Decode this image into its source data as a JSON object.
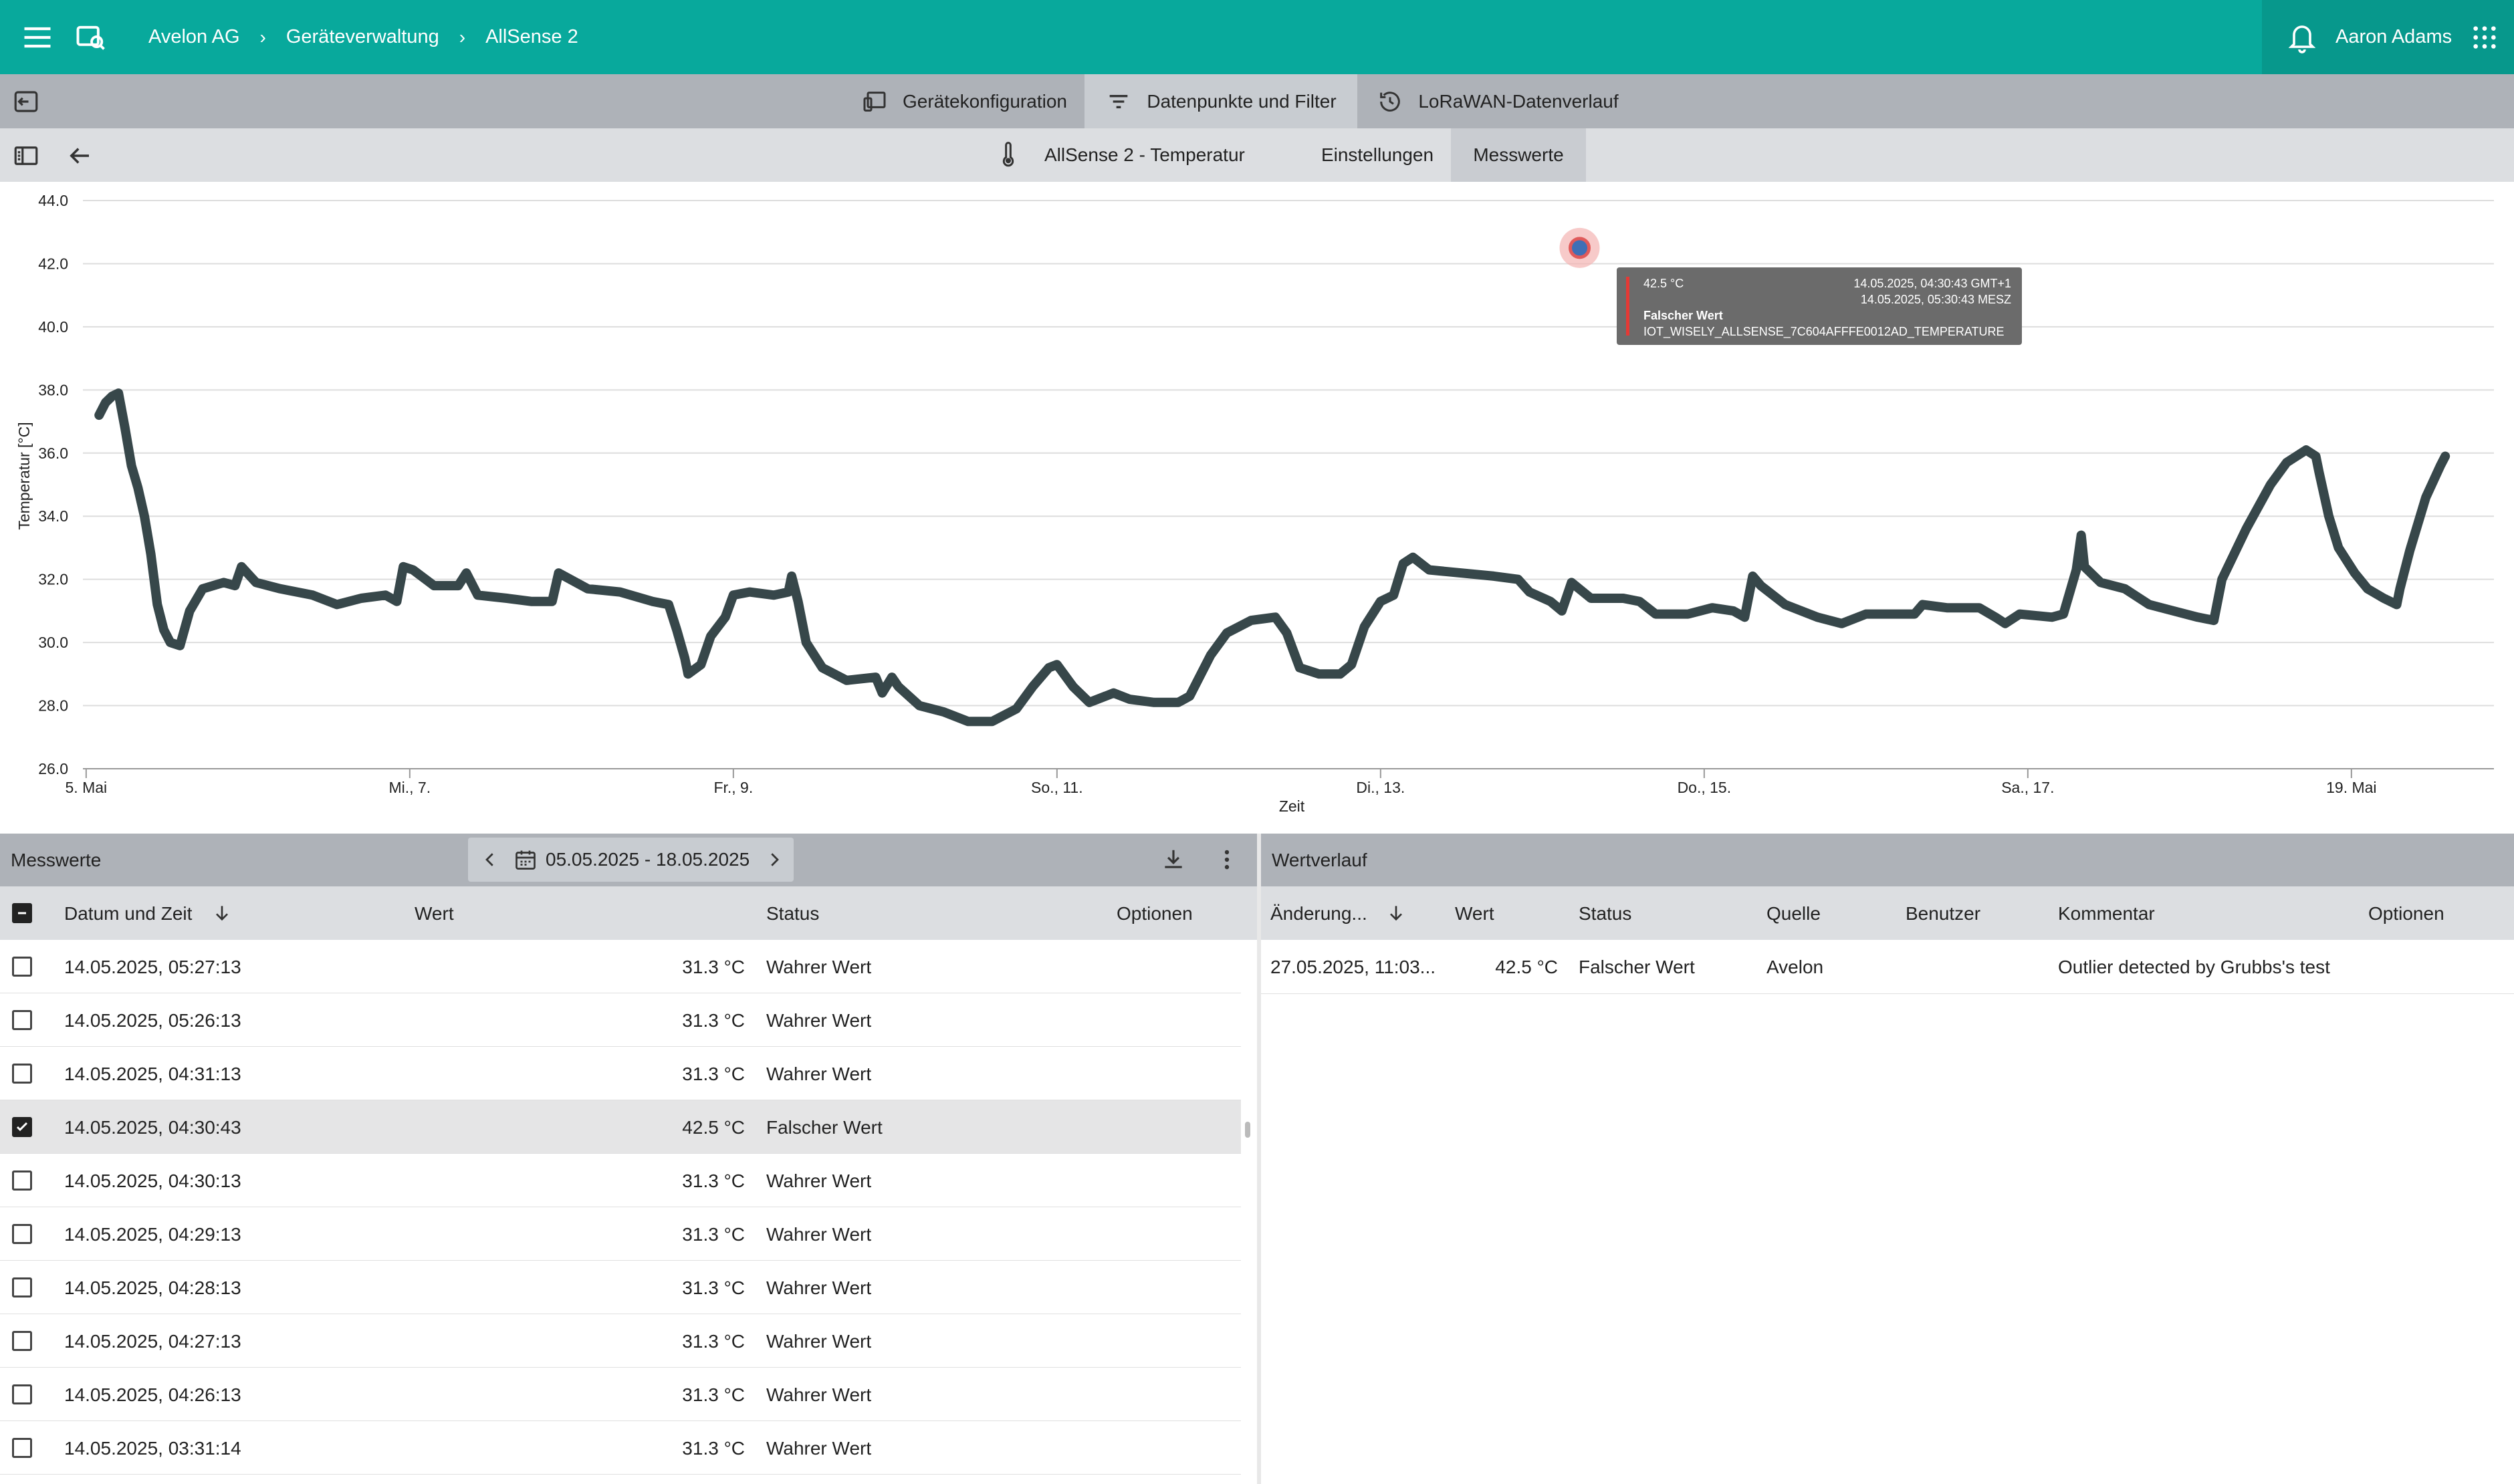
{
  "topbar": {
    "breadcrumb": [
      "Avelon AG",
      "Geräteverwaltung",
      "AllSense 2"
    ],
    "breadcrumb_sep": "›",
    "user_name": "Aaron Adams",
    "color": "#08a99c"
  },
  "tabs_main": [
    {
      "label": "Gerätekonfiguration",
      "icon": "devices-icon",
      "active": false
    },
    {
      "label": "Datenpunkte und Filter",
      "icon": "filter-icon",
      "active": true
    },
    {
      "label": "LoRaWAN-Datenverlauf",
      "icon": "history-icon",
      "active": false
    }
  ],
  "tabs_sub": {
    "datapoint": "AllSense 2 - Temperatur",
    "settings": "Einstellungen",
    "values": "Messwerte"
  },
  "chart_data": {
    "type": "line",
    "xlabel": "Zeit",
    "ylabel": "Temperatur [°C]",
    "ylim": [
      26,
      44
    ],
    "yticks": [
      "44.0",
      "42.0",
      "40.0",
      "38.0",
      "36.0",
      "34.0",
      "32.0",
      "30.0",
      "28.0",
      "26.0"
    ],
    "xlim_days": [
      5,
      19.5
    ],
    "xticks": [
      {
        "day": 5,
        "label": "5. Mai"
      },
      {
        "day": 7,
        "label": "Mi., 7."
      },
      {
        "day": 9,
        "label": "Fr., 9."
      },
      {
        "day": 11,
        "label": "So., 11."
      },
      {
        "day": 13,
        "label": "Di., 13."
      },
      {
        "day": 15,
        "label": "Do., 15."
      },
      {
        "day": 17,
        "label": "Sa., 17."
      },
      {
        "day": 19,
        "label": "19. Mai"
      }
    ],
    "grid": true,
    "series": [
      {
        "color": "#37474a",
        "points": [
          [
            5.08,
            37.2
          ],
          [
            5.12,
            37.6
          ],
          [
            5.16,
            37.8
          ],
          [
            5.2,
            37.9
          ],
          [
            5.24,
            36.8
          ],
          [
            5.28,
            35.6
          ],
          [
            5.32,
            34.9
          ],
          [
            5.36,
            34.0
          ],
          [
            5.4,
            32.8
          ],
          [
            5.44,
            31.2
          ],
          [
            5.48,
            30.4
          ],
          [
            5.52,
            30.0
          ],
          [
            5.58,
            29.9
          ],
          [
            5.64,
            31.0
          ],
          [
            5.72,
            31.7
          ],
          [
            5.85,
            31.9
          ],
          [
            5.92,
            31.8
          ],
          [
            5.96,
            32.4
          ],
          [
            6.05,
            31.9
          ],
          [
            6.2,
            31.7
          ],
          [
            6.4,
            31.5
          ],
          [
            6.55,
            31.2
          ],
          [
            6.7,
            31.4
          ],
          [
            6.85,
            31.5
          ],
          [
            6.92,
            31.3
          ],
          [
            6.96,
            32.4
          ],
          [
            7.02,
            32.3
          ],
          [
            7.15,
            31.8
          ],
          [
            7.3,
            31.8
          ],
          [
            7.35,
            32.2
          ],
          [
            7.42,
            31.5
          ],
          [
            7.6,
            31.4
          ],
          [
            7.75,
            31.3
          ],
          [
            7.88,
            31.3
          ],
          [
            7.92,
            32.2
          ],
          [
            8.1,
            31.7
          ],
          [
            8.3,
            31.6
          ],
          [
            8.5,
            31.3
          ],
          [
            8.6,
            31.2
          ],
          [
            8.65,
            30.4
          ],
          [
            8.7,
            29.5
          ],
          [
            8.72,
            29.0
          ],
          [
            8.8,
            29.3
          ],
          [
            8.86,
            30.2
          ],
          [
            8.95,
            30.8
          ],
          [
            9.0,
            31.5
          ],
          [
            9.1,
            31.6
          ],
          [
            9.25,
            31.5
          ],
          [
            9.34,
            31.6
          ],
          [
            9.36,
            32.1
          ],
          [
            9.4,
            31.3
          ],
          [
            9.45,
            30.0
          ],
          [
            9.55,
            29.2
          ],
          [
            9.7,
            28.8
          ],
          [
            9.88,
            28.9
          ],
          [
            9.92,
            28.4
          ],
          [
            9.98,
            28.9
          ],
          [
            10.02,
            28.6
          ],
          [
            10.15,
            28.0
          ],
          [
            10.3,
            27.8
          ],
          [
            10.45,
            27.5
          ],
          [
            10.6,
            27.5
          ],
          [
            10.75,
            27.9
          ],
          [
            10.85,
            28.6
          ],
          [
            10.95,
            29.2
          ],
          [
            11.0,
            29.3
          ],
          [
            11.1,
            28.6
          ],
          [
            11.2,
            28.1
          ],
          [
            11.35,
            28.4
          ],
          [
            11.45,
            28.2
          ],
          [
            11.6,
            28.1
          ],
          [
            11.75,
            28.1
          ],
          [
            11.82,
            28.3
          ],
          [
            11.95,
            29.6
          ],
          [
            12.05,
            30.3
          ],
          [
            12.2,
            30.7
          ],
          [
            12.35,
            30.8
          ],
          [
            12.42,
            30.3
          ],
          [
            12.5,
            29.2
          ],
          [
            12.62,
            29.0
          ],
          [
            12.75,
            29.0
          ],
          [
            12.82,
            29.3
          ],
          [
            12.9,
            30.5
          ],
          [
            13.0,
            31.3
          ],
          [
            13.08,
            31.5
          ],
          [
            13.14,
            32.5
          ],
          [
            13.2,
            32.7
          ],
          [
            13.3,
            32.3
          ],
          [
            13.5,
            32.2
          ],
          [
            13.7,
            32.1
          ],
          [
            13.85,
            32.0
          ],
          [
            13.92,
            31.6
          ],
          [
            14.05,
            31.3
          ],
          [
            14.12,
            31.0
          ],
          [
            14.18,
            31.9
          ],
          [
            14.3,
            31.4
          ],
          [
            14.5,
            31.4
          ],
          [
            14.6,
            31.3
          ],
          [
            14.7,
            30.9
          ],
          [
            14.9,
            30.9
          ],
          [
            15.05,
            31.1
          ],
          [
            15.18,
            31.0
          ],
          [
            15.25,
            30.8
          ],
          [
            15.3,
            32.1
          ],
          [
            15.35,
            31.8
          ],
          [
            15.5,
            31.2
          ],
          [
            15.7,
            30.8
          ],
          [
            15.85,
            30.6
          ],
          [
            16.0,
            30.9
          ],
          [
            16.2,
            30.9
          ],
          [
            16.3,
            30.9
          ],
          [
            16.35,
            31.2
          ],
          [
            16.5,
            31.1
          ],
          [
            16.7,
            31.1
          ],
          [
            16.8,
            30.8
          ],
          [
            16.86,
            30.6
          ],
          [
            16.95,
            30.9
          ],
          [
            17.15,
            30.8
          ],
          [
            17.22,
            30.9
          ],
          [
            17.3,
            32.3
          ],
          [
            17.33,
            33.4
          ],
          [
            17.35,
            32.4
          ],
          [
            17.45,
            31.9
          ],
          [
            17.6,
            31.7
          ],
          [
            17.75,
            31.2
          ],
          [
            17.9,
            31.0
          ],
          [
            18.05,
            30.8
          ],
          [
            18.15,
            30.7
          ],
          [
            18.2,
            32.0
          ],
          [
            18.35,
            33.6
          ],
          [
            18.5,
            35.0
          ],
          [
            18.6,
            35.7
          ],
          [
            18.72,
            36.1
          ],
          [
            18.78,
            35.9
          ],
          [
            18.8,
            35.4
          ],
          [
            18.86,
            34.0
          ],
          [
            18.92,
            33.0
          ],
          [
            19.02,
            32.2
          ],
          [
            19.1,
            31.7
          ],
          [
            19.2,
            31.4
          ],
          [
            19.28,
            31.2
          ],
          [
            19.3,
            31.7
          ],
          [
            19.36,
            32.9
          ],
          [
            19.46,
            34.6
          ],
          [
            19.55,
            35.6
          ],
          [
            19.58,
            35.9
          ]
        ]
      }
    ],
    "highlight": {
      "day": 14.23,
      "value": 42.5
    }
  },
  "tooltip": {
    "value": "42.5 °C",
    "ts_utc": "14.05.2025, 04:30:43 GMT+1",
    "ts_local": "14.05.2025, 05:30:43 MESZ",
    "status": "Falscher Wert",
    "datapoint": "IOT_WISELY_ALLSENSE_7C604AFFFE0012AD_TEMPERATURE",
    "marker_color": "#e53935"
  },
  "measurements": {
    "title": "Messwerte",
    "date_range": "05.05.2025 - 18.05.2025",
    "columns": {
      "datetime": "Datum und Zeit",
      "value": "Wert",
      "status": "Status",
      "options": "Optionen"
    },
    "rows": [
      {
        "datetime": "14.05.2025, 05:27:13",
        "value": "31.3 °C",
        "status": "Wahrer Wert",
        "checked": false
      },
      {
        "datetime": "14.05.2025, 05:26:13",
        "value": "31.3 °C",
        "status": "Wahrer Wert",
        "checked": false
      },
      {
        "datetime": "14.05.2025, 04:31:13",
        "value": "31.3 °C",
        "status": "Wahrer Wert",
        "checked": false
      },
      {
        "datetime": "14.05.2025, 04:30:43",
        "value": "42.5 °C",
        "status": "Falscher Wert",
        "checked": true
      },
      {
        "datetime": "14.05.2025, 04:30:13",
        "value": "31.3 °C",
        "status": "Wahrer Wert",
        "checked": false
      },
      {
        "datetime": "14.05.2025, 04:29:13",
        "value": "31.3 °C",
        "status": "Wahrer Wert",
        "checked": false
      },
      {
        "datetime": "14.05.2025, 04:28:13",
        "value": "31.3 °C",
        "status": "Wahrer Wert",
        "checked": false
      },
      {
        "datetime": "14.05.2025, 04:27:13",
        "value": "31.3 °C",
        "status": "Wahrer Wert",
        "checked": false
      },
      {
        "datetime": "14.05.2025, 04:26:13",
        "value": "31.3 °C",
        "status": "Wahrer Wert",
        "checked": false
      },
      {
        "datetime": "14.05.2025, 03:31:14",
        "value": "31.3 °C",
        "status": "Wahrer Wert",
        "checked": false
      }
    ]
  },
  "history": {
    "title": "Wertverlauf",
    "columns": {
      "changed": "Änderung...",
      "value": "Wert",
      "status": "Status",
      "source": "Quelle",
      "user": "Benutzer",
      "comment": "Kommentar",
      "options": "Optionen"
    },
    "rows": [
      {
        "changed": "27.05.2025, 11:03...",
        "value": "42.5 °C",
        "status": "Falscher Wert",
        "source": "Avelon",
        "user": "",
        "comment": "Outlier detected by Grubbs's test"
      }
    ]
  }
}
